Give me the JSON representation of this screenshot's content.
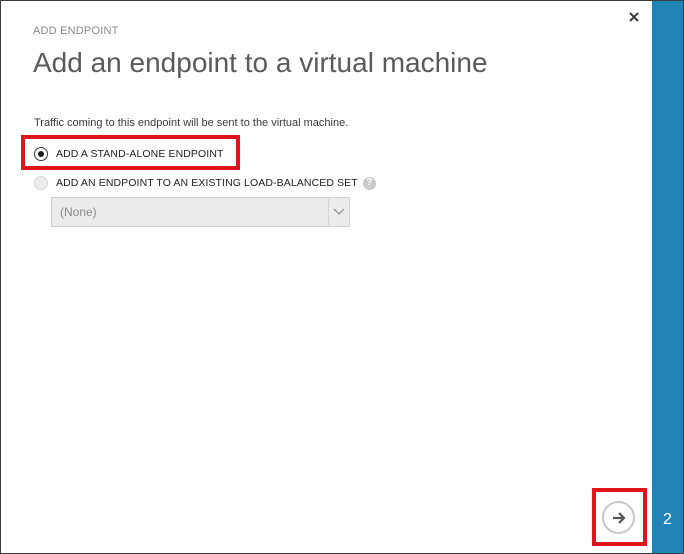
{
  "dialog": {
    "eyebrow": "ADD ENDPOINT",
    "title": "Add an endpoint to a virtual machine",
    "description": "Traffic coming to this endpoint will be sent to the virtual machine."
  },
  "options": [
    {
      "label": "ADD A STAND-ALONE ENDPOINT",
      "selected": true,
      "enabled": true
    },
    {
      "label": "ADD AN ENDPOINT TO AN EXISTING LOAD-BALANCED SET",
      "selected": false,
      "enabled": false
    }
  ],
  "load_balanced_set_select": {
    "value": "(None)",
    "enabled": false
  },
  "wizard": {
    "step": "2"
  },
  "icons": {
    "close": "close-icon",
    "help": "help-icon",
    "dropdown": "chevron-down-icon",
    "next": "arrow-right-icon"
  },
  "colors": {
    "sidebar": "#2183b6",
    "highlight": "#e0141b",
    "title_text": "#5a5a5a"
  }
}
